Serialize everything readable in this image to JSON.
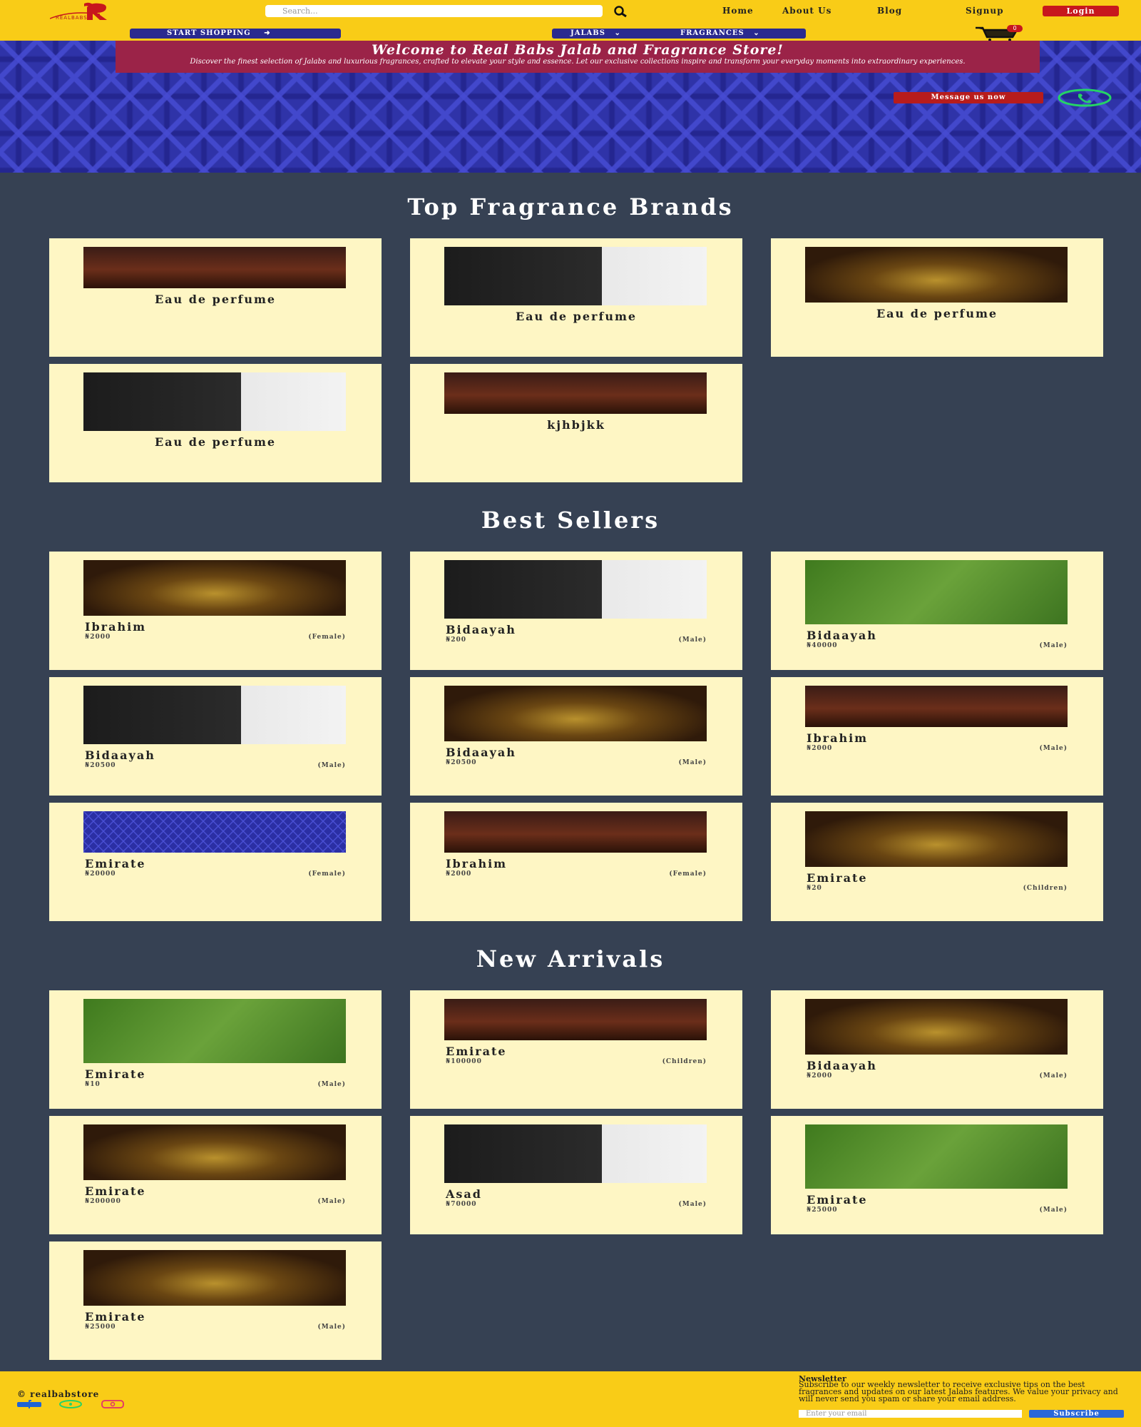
{
  "header": {
    "logo_text": "REALBABS",
    "search_placeholder": "Search...",
    "nav": {
      "home": "Home",
      "about": "About Us",
      "blog": "Blog",
      "signup": "Signup"
    },
    "login_label": "Login",
    "start_shopping": "START SHOPPING",
    "jalabs": "JALABS",
    "fragrances": "FRAGRANCES",
    "cart_count": "0"
  },
  "hero": {
    "title": "Welcome to Real Babs Jalab and Fragrance Store!",
    "subtitle": "Discover the finest selection of Jalabs and luxurious fragrances, crafted to elevate your style and essence. Let our exclusive collections inspire and transform your everyday moments into extraordinary experiences.",
    "message_button": "Message us now"
  },
  "sections": {
    "brands_title": "Top Fragrance Brands",
    "best_title": "Best Sellers",
    "new_title": "New Arrivals"
  },
  "brands": [
    {
      "name": "Eau de perfume",
      "image": "perfume"
    },
    {
      "name": "Eau de perfume",
      "image": "asad"
    },
    {
      "name": "Eau de perfume",
      "image": "brand"
    },
    {
      "name": "Eau de perfume",
      "image": "asad"
    },
    {
      "name": "kjhbjkk",
      "image": "perfume"
    }
  ],
  "best_sellers": [
    {
      "name": "Ibrahim",
      "price": "₦2000",
      "gender": "(Female)",
      "image": "brand"
    },
    {
      "name": "Bidaayah",
      "price": "₦200",
      "gender": "(Male)",
      "image": "asad"
    },
    {
      "name": "Bidaayah",
      "price": "₦40000",
      "gender": "(Male)",
      "image": "jalab"
    },
    {
      "name": "Bidaayah",
      "price": "₦20500",
      "gender": "(Male)",
      "image": "asad"
    },
    {
      "name": "Bidaayah",
      "price": "₦20500",
      "gender": "(Male)",
      "image": "brand"
    },
    {
      "name": "Ibrahim",
      "price": "₦2000",
      "gender": "(Male)",
      "image": "perfume"
    },
    {
      "name": "Emirate",
      "price": "₦20000",
      "gender": "(Female)",
      "image": "blue"
    },
    {
      "name": "Ibrahim",
      "price": "₦2000",
      "gender": "(Female)",
      "image": "perfume"
    },
    {
      "name": "Emirate",
      "price": "₦20",
      "gender": "(Children)",
      "image": "brand"
    }
  ],
  "new_arrivals": [
    {
      "name": "Emirate",
      "price": "₦10",
      "gender": "(Male)",
      "image": "jalab"
    },
    {
      "name": "Emirate",
      "price": "₦100000",
      "gender": "(Children)",
      "image": "perfume"
    },
    {
      "name": "Bidaayah",
      "price": "₦2000",
      "gender": "(Male)",
      "image": "brand"
    },
    {
      "name": "Emirate",
      "price": "₦200000",
      "gender": "(Male)",
      "image": "brand"
    },
    {
      "name": "Asad",
      "price": "₦70000",
      "gender": "(Male)",
      "image": "asad"
    },
    {
      "name": "Emirate",
      "price": "₦25000",
      "gender": "(Male)",
      "image": "jalab"
    },
    {
      "name": "Emirate",
      "price": "₦25000",
      "gender": "(Male)",
      "image": "brand"
    }
  ],
  "footer": {
    "copyright": "© realbabstore",
    "newsletter_title": "Newsletter",
    "newsletter_text": "Subscribe to our weekly newsletter to receive exclusive tips on the best fragrances and updates on our latest Jalabs features. We value your privacy and will never send you spam or share your email address.",
    "email_placeholder": "Enter your email",
    "subscribe_label": "Subscribe"
  },
  "colors": {
    "header": "#f9cc17",
    "page": "#364153",
    "card": "#fef6c4",
    "accent_red": "#c7171d",
    "navy": "#2a2a8f",
    "hero_blue": "#2f33a8"
  }
}
